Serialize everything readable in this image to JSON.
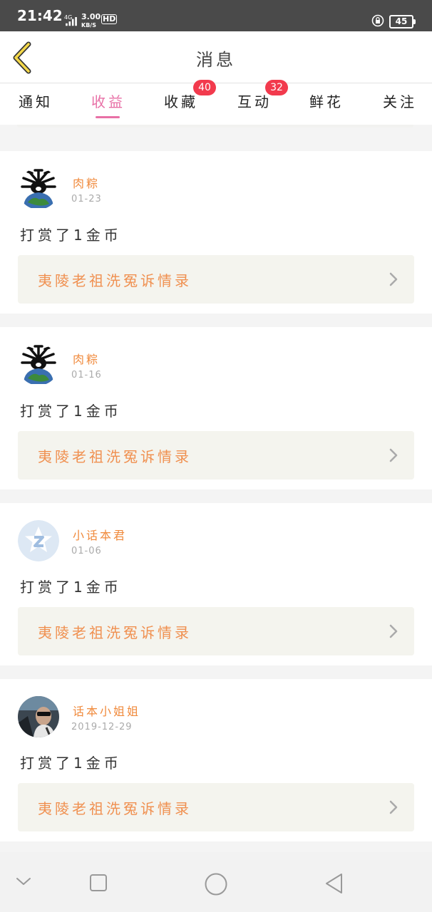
{
  "status_bar": {
    "time": "21:42",
    "network": "4G",
    "speed_value": "3.00",
    "speed_unit": "KB/S",
    "hd": "HD",
    "battery": "45"
  },
  "header": {
    "title": "消息",
    "back_icon": "chevron-left-icon"
  },
  "tabs": [
    {
      "label": "通知",
      "active": false
    },
    {
      "label": "收益",
      "active": true
    },
    {
      "label": "收藏",
      "badge": "40"
    },
    {
      "label": "互动",
      "badge": "32"
    },
    {
      "label": "鲜花"
    },
    {
      "label": "关注"
    }
  ],
  "colors": {
    "accent_pink": "#e870a6",
    "badge_red": "#f23a4d",
    "name_orange": "#f08a3c",
    "book_bg": "#f4f4ee"
  },
  "items": [
    {
      "name": "肉粽",
      "date": "01-23",
      "action": "打赏了1金币",
      "book": "夷陵老祖洗冤诉情录",
      "avatar": "dark-creature-globe-avatar"
    },
    {
      "name": "肉粽",
      "date": "01-16",
      "action": "打赏了1金币",
      "book": "夷陵老祖洗冤诉情录",
      "avatar": "dark-creature-globe-avatar"
    },
    {
      "name": "小话本君",
      "date": "01-06",
      "action": "打赏了1金币",
      "book": "夷陵老祖洗冤诉情录",
      "avatar": "blue-star-z-avatar"
    },
    {
      "name": "话本小姐姐",
      "date": "2019-12-29",
      "action": "打赏了1金币",
      "book": "夷陵老祖洗冤诉情录",
      "avatar": "photo-avatar"
    }
  ],
  "nav_bar": {
    "icons": [
      "collapse-chevron-icon",
      "recent-apps-square-icon",
      "home-circle-icon",
      "back-triangle-icon"
    ]
  }
}
